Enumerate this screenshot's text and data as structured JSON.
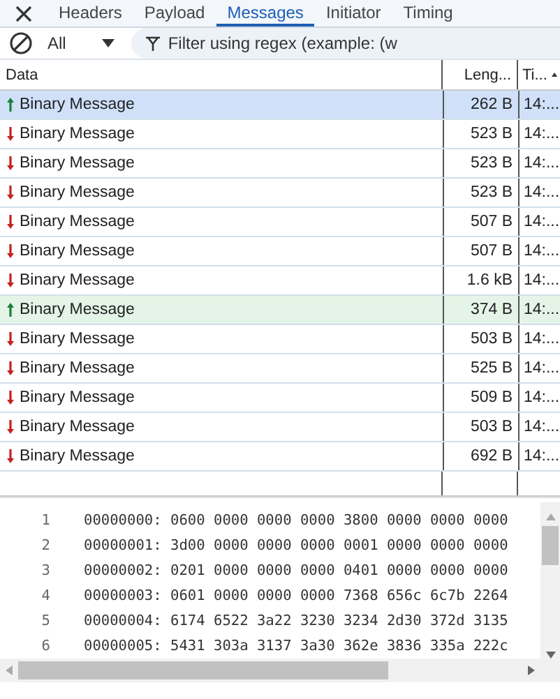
{
  "tabs": [
    {
      "label": "Headers",
      "selected": false
    },
    {
      "label": "Payload",
      "selected": false
    },
    {
      "label": "Messages",
      "selected": true
    },
    {
      "label": "Initiator",
      "selected": false
    },
    {
      "label": "Timing",
      "selected": false
    }
  ],
  "toolbar": {
    "filter_type": "All",
    "search": {
      "placeholder": "Filter using regex (example: (w"
    }
  },
  "table": {
    "columns": [
      {
        "label": "Data",
        "sorted": false
      },
      {
        "label": "Leng...",
        "sorted": false
      },
      {
        "label": "Ti...",
        "sorted": true
      }
    ],
    "rows": [
      {
        "kind": "sent",
        "data": "Binary Message",
        "length": "262 B",
        "time": "14:...",
        "selected": true
      },
      {
        "kind": "received",
        "data": "Binary Message",
        "length": "523 B",
        "time": "14:...",
        "selected": false
      },
      {
        "kind": "received",
        "data": "Binary Message",
        "length": "523 B",
        "time": "14:...",
        "selected": false
      },
      {
        "kind": "received",
        "data": "Binary Message",
        "length": "523 B",
        "time": "14:...",
        "selected": false
      },
      {
        "kind": "received",
        "data": "Binary Message",
        "length": "507 B",
        "time": "14:...",
        "selected": false
      },
      {
        "kind": "received",
        "data": "Binary Message",
        "length": "507 B",
        "time": "14:...",
        "selected": false
      },
      {
        "kind": "received",
        "data": "Binary Message",
        "length": "1.6 kB",
        "time": "14:...",
        "selected": false
      },
      {
        "kind": "sent",
        "data": "Binary Message",
        "length": "374 B",
        "time": "14:...",
        "selected": false
      },
      {
        "kind": "received",
        "data": "Binary Message",
        "length": "503 B",
        "time": "14:...",
        "selected": false
      },
      {
        "kind": "received",
        "data": "Binary Message",
        "length": "525 B",
        "time": "14:...",
        "selected": false
      },
      {
        "kind": "received",
        "data": "Binary Message",
        "length": "509 B",
        "time": "14:...",
        "selected": false
      },
      {
        "kind": "received",
        "data": "Binary Message",
        "length": "503 B",
        "time": "14:...",
        "selected": false
      },
      {
        "kind": "received",
        "data": "Binary Message",
        "length": "692 B",
        "time": "14:...",
        "selected": false
      }
    ]
  },
  "hex_view": {
    "lines": [
      {
        "number": "1",
        "text": "00000000: 0600 0000 0000 0000 3800 0000 0000 0000"
      },
      {
        "number": "2",
        "text": "00000001: 3d00 0000 0000 0000 0001 0000 0000 0000"
      },
      {
        "number": "3",
        "text": "00000002: 0201 0000 0000 0000 0401 0000 0000 0000"
      },
      {
        "number": "4",
        "text": "00000003: 0601 0000 0000 0000 7368 656c 6c7b 2264"
      },
      {
        "number": "5",
        "text": "00000004: 6174 6522 3a22 3230 3234 2d30 372d 3135"
      },
      {
        "number": "6",
        "text": "00000005: 5431 303a 3137 3a30 362e 3836 335a 222c"
      }
    ]
  }
}
